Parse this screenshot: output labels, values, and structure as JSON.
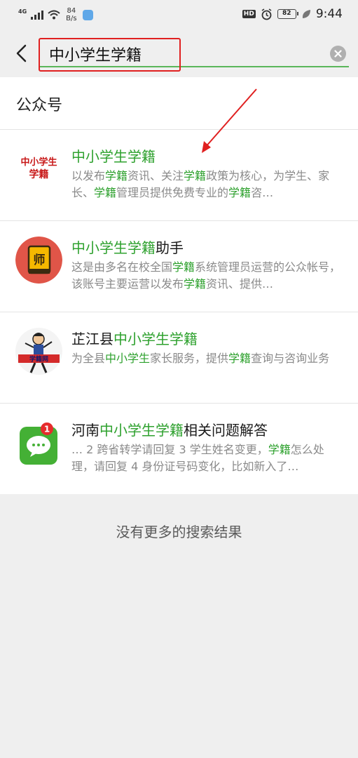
{
  "status_bar": {
    "network": "4G",
    "speed_value": "84",
    "speed_unit": "B/s",
    "hd": "HD",
    "battery": "82",
    "time": "9:44"
  },
  "search": {
    "query": "中小学生学籍"
  },
  "section": {
    "title": "公众号"
  },
  "results": [
    {
      "title": [
        {
          "t": "中小学生学籍",
          "h": true
        }
      ],
      "desc": [
        {
          "t": "以发布"
        },
        {
          "t": "学籍",
          "h": true
        },
        {
          "t": "资讯、关注"
        },
        {
          "t": "学籍",
          "h": true
        },
        {
          "t": "政策为核心，为学生、家长、"
        },
        {
          "t": "学籍",
          "h": true
        },
        {
          "t": "管理员提供免费专业的"
        },
        {
          "t": "学籍",
          "h": true
        },
        {
          "t": "咨…"
        }
      ]
    },
    {
      "title": [
        {
          "t": "中小学生学籍",
          "h": true
        },
        {
          "t": "助手"
        }
      ],
      "desc": [
        {
          "t": "这是由多名在校全国"
        },
        {
          "t": "学籍",
          "h": true
        },
        {
          "t": "系统管理员运营的公众帐号，该账号主要运营以发布"
        },
        {
          "t": "学籍",
          "h": true
        },
        {
          "t": "资讯、提供…"
        }
      ]
    },
    {
      "title": [
        {
          "t": "芷江县"
        },
        {
          "t": "中小学生学籍",
          "h": true
        }
      ],
      "desc": [
        {
          "t": "为全县"
        },
        {
          "t": "中小学生",
          "h": true
        },
        {
          "t": "家长服务，提供"
        },
        {
          "t": "学籍",
          "h": true
        },
        {
          "t": "查询与咨询业务"
        }
      ]
    },
    {
      "title": [
        {
          "t": "河南"
        },
        {
          "t": "中小学生学籍",
          "h": true
        },
        {
          "t": "相关问题解答"
        }
      ],
      "desc": [
        {
          "t": "… 2 跨省转学请回复 3 学生姓名变更，"
        },
        {
          "t": "学籍",
          "h": true
        },
        {
          "t": "怎么处理，请回复 4 身份证号码变化，比如新入了…"
        }
      ]
    }
  ],
  "avatars": {
    "a1_text_top": "中小学生",
    "a1_text_bottom": "学籍",
    "a2_char": "师",
    "a3_banner": "学籍网",
    "a4_badge": "1"
  },
  "footer": {
    "no_more": "没有更多的搜索结果"
  },
  "colors": {
    "highlight_green": "#2ea12e",
    "annotation_red": "#e02020"
  }
}
